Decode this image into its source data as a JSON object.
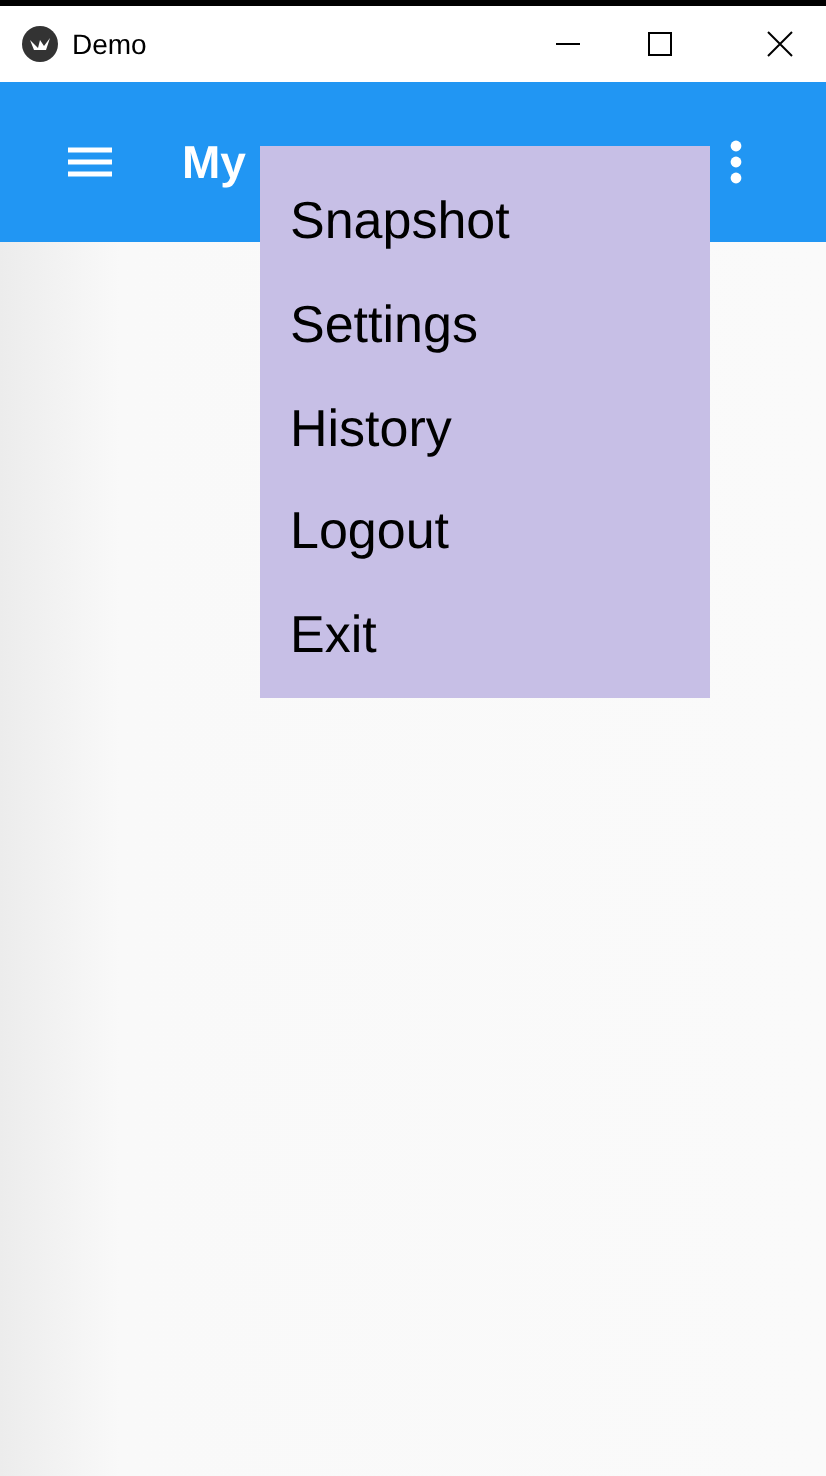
{
  "window": {
    "title": "Demo"
  },
  "app_bar": {
    "title": "My"
  },
  "menu": {
    "items": [
      {
        "label": "Snapshot"
      },
      {
        "label": "Settings"
      },
      {
        "label": "History"
      },
      {
        "label": "Logout"
      },
      {
        "label": "Exit"
      }
    ]
  }
}
